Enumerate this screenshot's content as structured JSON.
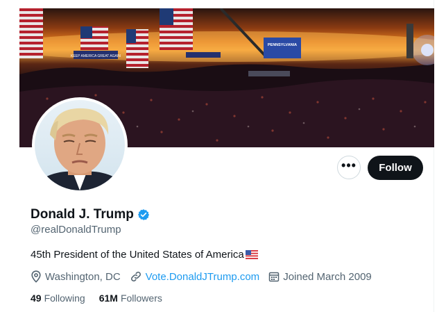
{
  "profile": {
    "display_name": "Donald J. Trump",
    "handle": "@realDonaldTrump",
    "bio": "45th President of the United States of America",
    "location": "Washington, DC",
    "website": "Vote.DonaldJTrump.com",
    "joined": "Joined March 2009",
    "following_count": "49",
    "following_label": "Following",
    "followers_count": "61M",
    "followers_label": "Followers"
  },
  "actions": {
    "more_label": "•••",
    "follow_label": "Follow"
  },
  "banner": {
    "signs": [
      "PENNSYLVANIA",
      "KEEP AMERICA GREAT AGAIN"
    ]
  },
  "colors": {
    "accent": "#1d9bf0",
    "follow_bg": "#0f1419",
    "secondary_text": "#536471",
    "verified": "#1d9bf0"
  },
  "icons": {
    "verified": "verified-badge-icon",
    "flag": "us-flag-icon",
    "location": "location-pin-icon",
    "link": "link-icon",
    "calendar": "calendar-icon",
    "more": "more-horizontal-icon"
  }
}
